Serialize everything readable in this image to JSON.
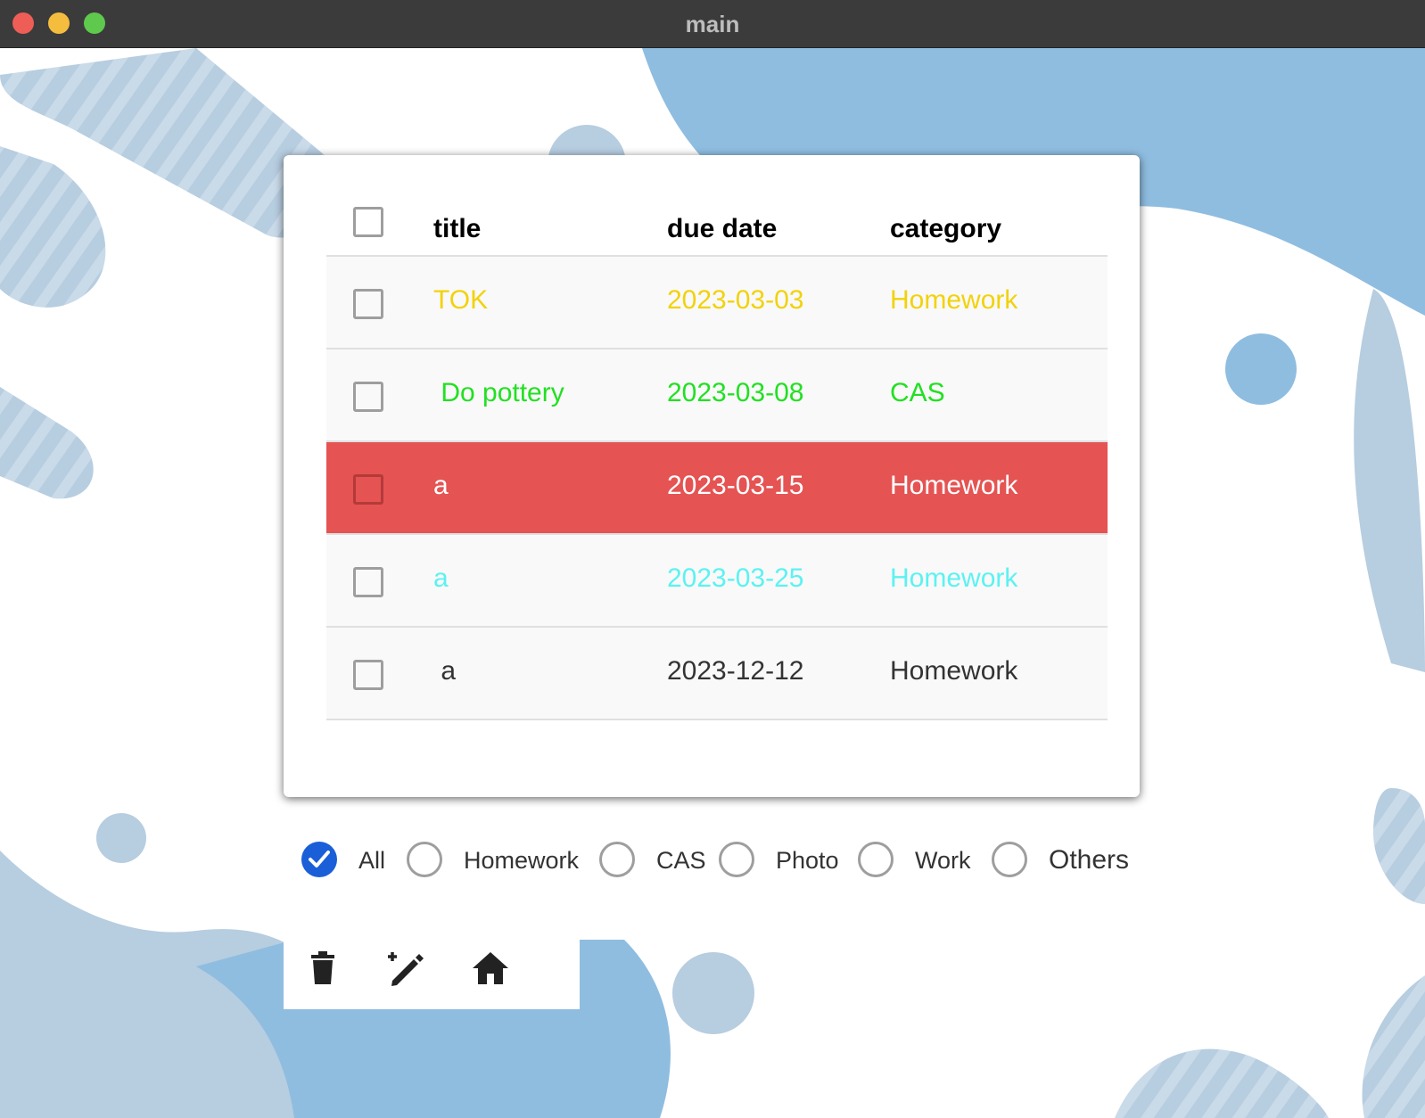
{
  "window": {
    "title": "main"
  },
  "table": {
    "headers": {
      "title": "title",
      "due_date": "due date",
      "category": "category"
    },
    "rows": [
      {
        "title": "TOK",
        "due_date": "2023-03-03",
        "category": "Homework",
        "color": "#f2d20a",
        "bg": "#f9f9f9"
      },
      {
        "title": " Do pottery",
        "due_date": "2023-03-08",
        "category": "CAS",
        "color": "#22e022",
        "bg": "#f9f9f9"
      },
      {
        "title": "a",
        "due_date": "2023-03-15",
        "category": "Homework",
        "color": "#ffffff",
        "bg": "#e55353"
      },
      {
        "title": "a",
        "due_date": "2023-03-25",
        "category": "Homework",
        "color": "#5cf2f2",
        "bg": "#f9f9f9"
      },
      {
        "title": " a",
        "due_date": "2023-12-12",
        "category": "Homework",
        "color": "#333333",
        "bg": "#f9f9f9"
      }
    ]
  },
  "filters": {
    "options": [
      "All",
      "Homework",
      "CAS",
      "Photo",
      "Work",
      "Others"
    ],
    "selected": "All"
  },
  "toolbar": {
    "icons": [
      "trash-icon",
      "edit-magic-icon",
      "home-icon"
    ]
  },
  "colors": {
    "titlebar": "#3b3b3b",
    "accent_blue": "#1a5fd8",
    "bg_blue": "#8fbde0",
    "bg_grey_blue": "#b7cde0",
    "overdue_row": "#e55353"
  }
}
